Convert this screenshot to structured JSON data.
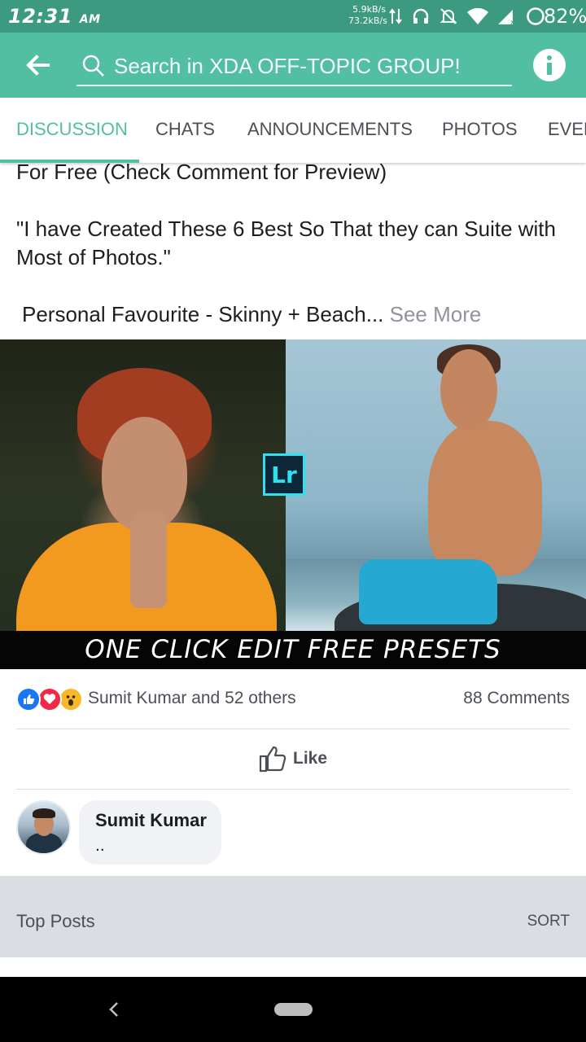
{
  "status_bar": {
    "time": "12:31",
    "ampm": "AM",
    "upload_speed": "5.9kB/s",
    "download_speed": "73.2kB/s",
    "battery": "82%"
  },
  "app_bar": {
    "search_placeholder": "Search in XDA OFF-TOPIC GROUP!",
    "colors": {
      "status": "#3b9a80",
      "bar": "#52bfa2"
    }
  },
  "tabs": [
    {
      "label": "DISCUSSION",
      "active": true
    },
    {
      "label": "CHATS",
      "active": false
    },
    {
      "label": "ANNOUNCEMENTS",
      "active": false
    },
    {
      "label": "PHOTOS",
      "active": false
    },
    {
      "label": "EVENTS",
      "active": false
    }
  ],
  "post": {
    "line1": "For Free (Check Comment for Preview)",
    "line2": "\"I have Created These 6 Best So That they can Suite with Most of Photos.\"",
    "line3": "Personal Favourite - Skinny + Beach...",
    "see_more": "See More",
    "image": {
      "logo_text": "Lr",
      "banner_text": "ONE CLICK EDIT FREE PRESETS"
    }
  },
  "reactions": {
    "icons": [
      "like-icon",
      "love-icon",
      "wow-icon"
    ],
    "names": "Sumit Kumar and 52 others",
    "comments": "88 Comments"
  },
  "actions": {
    "like_label": "Like"
  },
  "comment": {
    "author": "Sumit Kumar",
    "text": ".."
  },
  "top_posts": {
    "label": "Top Posts",
    "sort_label": "SORT"
  }
}
